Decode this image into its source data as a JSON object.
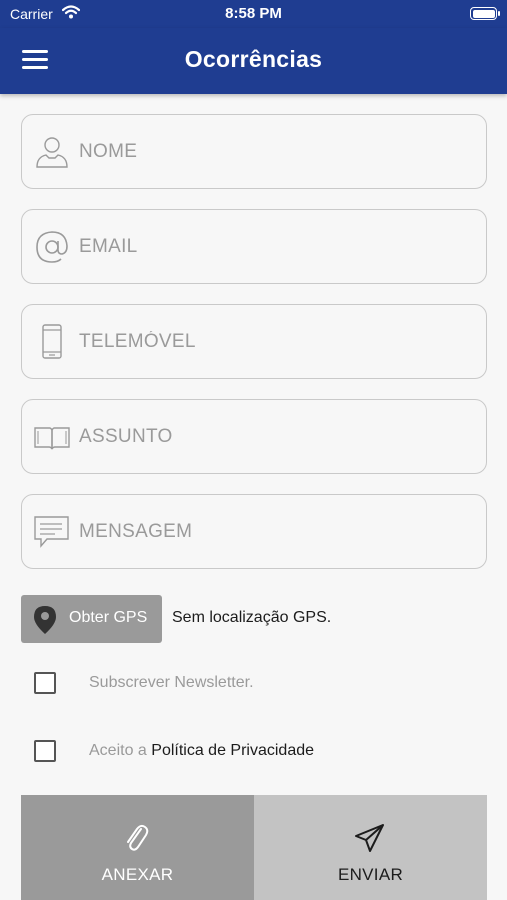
{
  "status_bar": {
    "carrier": "Carrier",
    "time": "8:58 PM"
  },
  "header": {
    "title": "Ocorrências"
  },
  "form": {
    "nome": {
      "placeholder": "NOME",
      "icon": "user-icon"
    },
    "email": {
      "placeholder": "EMAIL",
      "icon": "at-icon"
    },
    "telemovel": {
      "placeholder": "TELEMÓVEL",
      "icon": "phone-icon"
    },
    "assunto": {
      "placeholder": "ASSUNTO",
      "icon": "book-icon"
    },
    "mensagem": {
      "placeholder": "MENSAGEM",
      "icon": "message-icon"
    }
  },
  "gps": {
    "button_label": "Obter GPS",
    "status": "Sem localização GPS."
  },
  "newsletter": {
    "label": "Subscrever Newsletter.",
    "checked": false
  },
  "privacy": {
    "prefix": "Aceito a ",
    "link": "Política de Privacidade",
    "checked": false
  },
  "actions": {
    "anexar": "ANEXAR",
    "enviar": "ENVIAR"
  },
  "colors": {
    "primary": "#1f3d91",
    "field_border": "#c9c9c9",
    "button_dark": "#9a9a9a",
    "button_light": "#c3c3c3"
  }
}
